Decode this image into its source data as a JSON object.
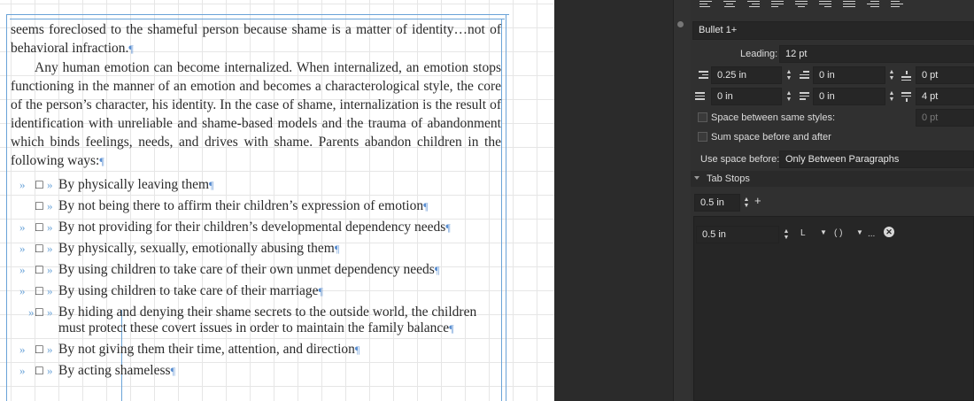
{
  "document": {
    "para1": "seems foreclosed to the shameful person because shame is a matter of identity…not of behavioral infraction.",
    "para2": "Any human emotion can become internalized. When internalized, an emotion stops functioning in the manner of an emotion and becomes a characterological style, the core of the person’s character, his identity. In the case of shame, internalization is the result of identification with unreliable and shame-based models and the trauma of abandonment which binds feelings, needs, and drives with shame. Parents abandon children in the following ways:",
    "pilcrow": "¶",
    "bullet_marker": "»",
    "checkbox_glyph": "☐",
    "bullets": [
      "By physically leaving them",
      "By not being there to affirm their children’s expression of emotion",
      "By not providing for their children’s developmental dependency needs",
      "By physically, sexually, emotionally abusing them",
      "By using children to take care of their own unmet dependency needs",
      "By using children to take care of their marriage",
      "By hiding and denying their shame secrets to the outside world, the children must protect these covert issues in order to maintain the family balance",
      "By not giving them their time, attention, and direction",
      "By acting shameless"
    ]
  },
  "panel": {
    "style_name": "Bullet 1+",
    "leading_label": "Leading:",
    "leading_value": "12 pt",
    "left_indent": "0.25 in",
    "first_line_indent": "0 in",
    "space_before": "0 pt",
    "right_indent": "0 in",
    "last_line_indent": "0 in",
    "space_after": "4 pt",
    "same_styles_label": "Space between same styles:",
    "same_styles_value": "0 pt",
    "sum_space_label": "Sum space before and after",
    "use_space_label": "Use space before:",
    "use_space_value": "Only Between Paragraphs",
    "tab_stops_label": "Tab Stops",
    "tab_default": "0.5 in",
    "tab_entry": "0.5 in",
    "tab_align_glyph": "L",
    "tab_leader_glyph": "( )",
    "more_glyph": "...",
    "clear_glyph": "✕",
    "add_tab_glyph": "+"
  }
}
